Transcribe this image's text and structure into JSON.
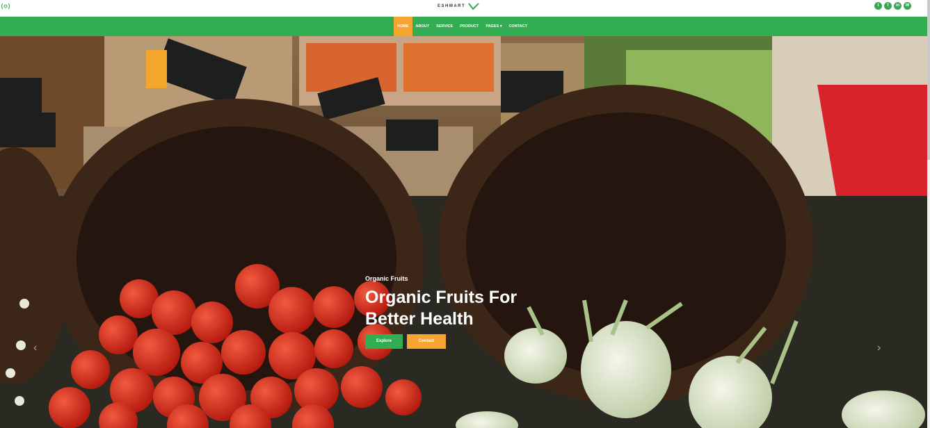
{
  "brand": {
    "name": "ESHMART",
    "top_left_icon": "broadcast-icon"
  },
  "socials": [
    {
      "icon": "twitter-icon",
      "glyph": "t"
    },
    {
      "icon": "facebook-icon",
      "glyph": "f"
    },
    {
      "icon": "linkedin-icon",
      "glyph": "in"
    },
    {
      "icon": "mail-icon",
      "glyph": "✉"
    }
  ],
  "nav": {
    "home": "HOME",
    "about": "ABOUT",
    "service": "SERVICE",
    "product": "PRODUCT",
    "pages": "PAGES ▾",
    "contact": "CONTACT"
  },
  "hero": {
    "subtitle": "Organic Fruits",
    "title": "Organic Fruits For Better Health",
    "explore_label": "Explore",
    "contact_label": "Contact",
    "prev_arrow": "‹",
    "next_arrow": "›"
  },
  "colors": {
    "green": "#33ad52",
    "orange": "#f7a531"
  }
}
